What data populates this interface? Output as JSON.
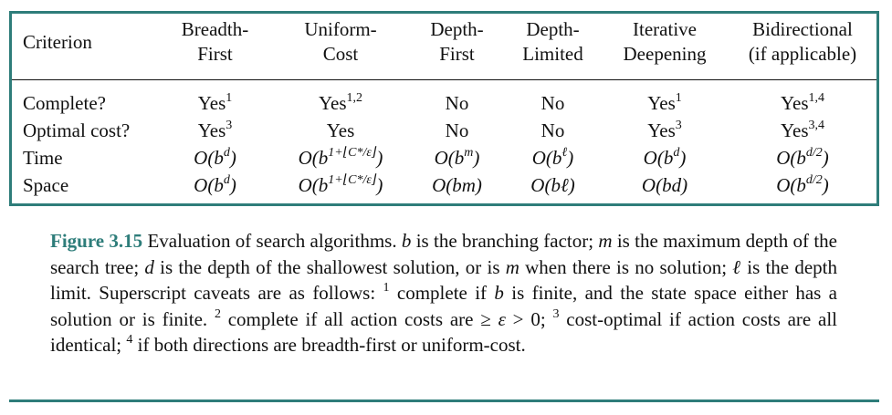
{
  "table": {
    "headers": [
      [
        "Criterion"
      ],
      [
        "Breadth-",
        "First"
      ],
      [
        "Uniform-",
        "Cost"
      ],
      [
        "Depth-",
        "First"
      ],
      [
        "Depth-",
        "Limited"
      ],
      [
        "Iterative",
        "Deepening"
      ],
      [
        "Bidirectional",
        "(if applicable)"
      ]
    ],
    "rows": [
      {
        "label": "Complete?",
        "cells": [
          {
            "text": "Yes",
            "sup": "1"
          },
          {
            "text": "Yes",
            "sup": "1,2"
          },
          {
            "text": "No"
          },
          {
            "text": "No"
          },
          {
            "text": "Yes",
            "sup": "1"
          },
          {
            "text": "Yes",
            "sup": "1,4"
          }
        ]
      },
      {
        "label": "Optimal cost?",
        "cells": [
          {
            "text": "Yes",
            "sup": "3"
          },
          {
            "text": "Yes"
          },
          {
            "text": "No"
          },
          {
            "text": "No"
          },
          {
            "text": "Yes",
            "sup": "3"
          },
          {
            "text": "Yes",
            "sup": "3,4"
          }
        ]
      },
      {
        "label": "Time",
        "cells": [
          {
            "math": "O(b",
            "sup": "d",
            "close": ")"
          },
          {
            "math": "O(b",
            "sup": "1+⌊C*/ε⌋",
            "close": ")"
          },
          {
            "math": "O(b",
            "sup": "m",
            "close": ")"
          },
          {
            "math": "O(b",
            "sup": "ℓ",
            "close": ")"
          },
          {
            "math": "O(b",
            "sup": "d",
            "close": ")"
          },
          {
            "math": "O(b",
            "sup": "d/2",
            "close": ")"
          }
        ]
      },
      {
        "label": "Space",
        "cells": [
          {
            "math": "O(b",
            "sup": "d",
            "close": ")"
          },
          {
            "math": "O(b",
            "sup": "1+⌊C*/ε⌋",
            "close": ")"
          },
          {
            "math": "O(bm)"
          },
          {
            "math": "O(bℓ)"
          },
          {
            "math": "O(bd)"
          },
          {
            "math": "O(b",
            "sup": "d/2",
            "close": ")"
          }
        ]
      }
    ]
  },
  "caption": {
    "label": "Figure 3.15",
    "segments": [
      {
        "t": "  Evaluation of search algorithms. "
      },
      {
        "m": "b"
      },
      {
        "t": " is the branching factor; "
      },
      {
        "m": "m"
      },
      {
        "t": " is the maximum depth of the search tree; "
      },
      {
        "m": "d"
      },
      {
        "t": " is the depth of the shallowest solution, or is "
      },
      {
        "m": "m"
      },
      {
        "t": " when there is no solution; "
      },
      {
        "m": "ℓ"
      },
      {
        "t": " is the depth limit. Superscript caveats are as follows: "
      },
      {
        "s": "1"
      },
      {
        "t": " complete if "
      },
      {
        "m": "b"
      },
      {
        "t": " is finite, and the state space either has a solution or is finite. "
      },
      {
        "s": "2"
      },
      {
        "t": " complete if all action costs are ≥ "
      },
      {
        "m": "ε"
      },
      {
        "t": " > 0; "
      },
      {
        "s": "3"
      },
      {
        "t": " cost-optimal if action costs are all identical; "
      },
      {
        "s": "4"
      },
      {
        "t": " if both directions are breadth-first or uniform-cost."
      }
    ]
  },
  "colors": {
    "accent": "#2e7d7a",
    "text": "#111111"
  }
}
